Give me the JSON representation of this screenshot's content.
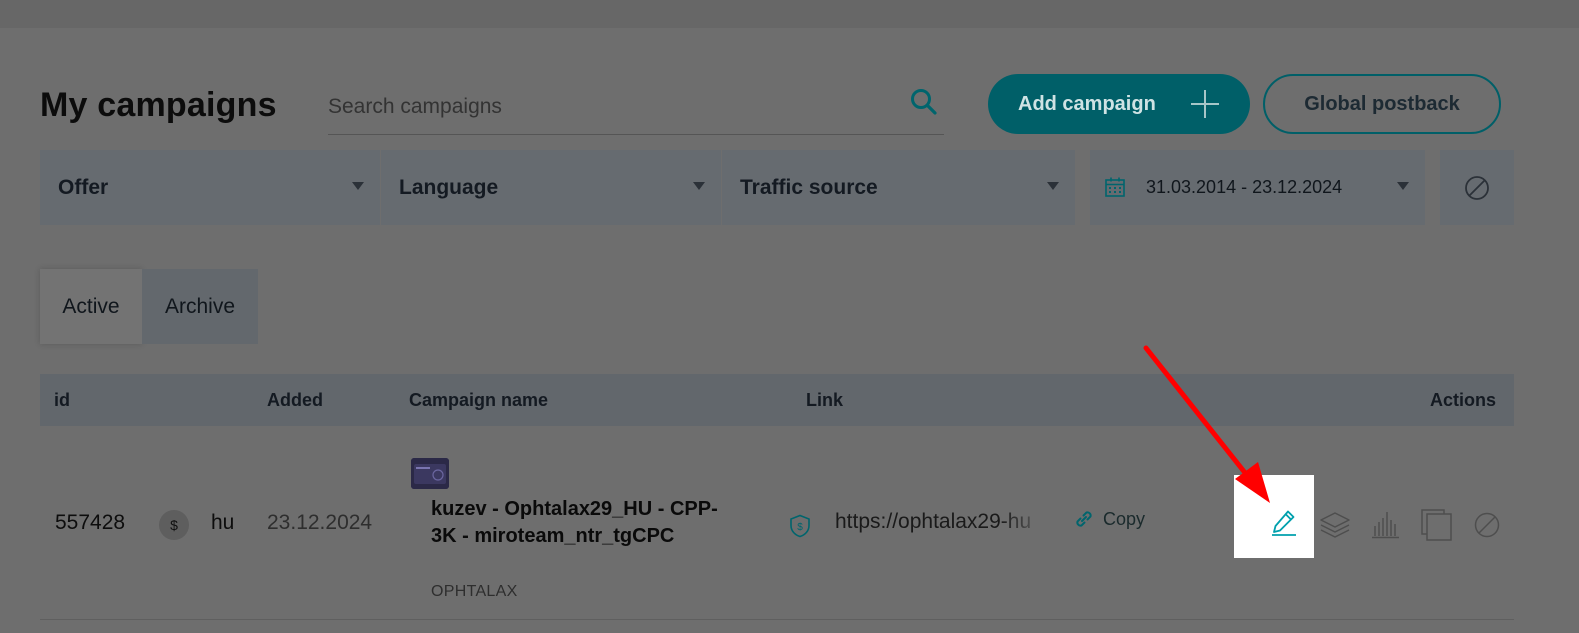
{
  "header": {
    "title": "My campaigns",
    "search_placeholder": "Search campaigns",
    "add_campaign_label": "Add campaign",
    "global_postback_label": "Global postback"
  },
  "filters": {
    "offer": "Offer",
    "language": "Language",
    "traffic_source": "Traffic source",
    "date_range": "31.03.2014 - 23.12.2024"
  },
  "tabs": {
    "active": "Active",
    "archive": "Archive"
  },
  "table": {
    "columns": {
      "id": "id",
      "added": "Added",
      "campaign_name": "Campaign name",
      "link": "Link",
      "actions": "Actions"
    },
    "rows": [
      {
        "id": "557428",
        "currency_symbol": "$",
        "lang": "hu",
        "added": "23.12.2024",
        "name": "kuzev - Ophtalax29_HU - CPP-3K - miroteam_ntr_tgCPC",
        "offer": "OPHTALAX",
        "link": "https://ophtalax29-hu",
        "copy_label": "Copy"
      }
    ]
  },
  "colors": {
    "accent": "#00a0ad",
    "annotation_arrow": "#ff0000"
  }
}
